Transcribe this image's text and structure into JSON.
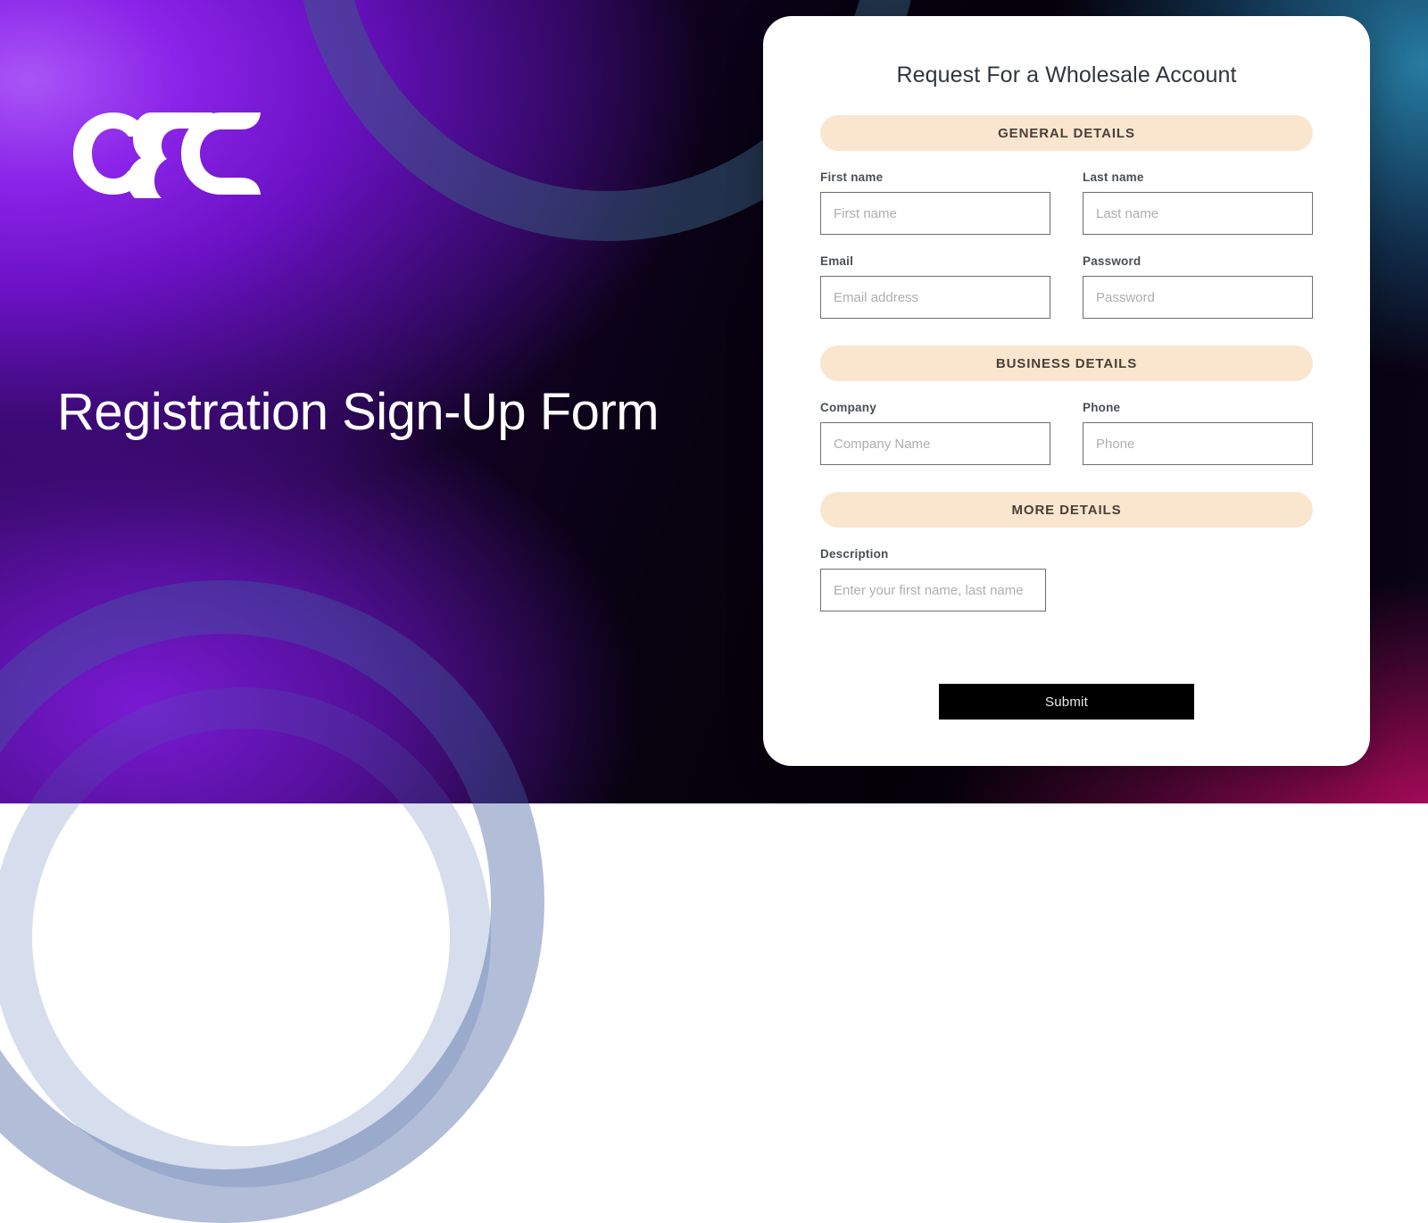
{
  "brand": {
    "logo_name": "osc-logo",
    "headline": "Registration Sign-Up Form"
  },
  "card": {
    "title": "Request For a Wholesale Account",
    "sections": [
      {
        "heading": "GENERAL DETAILS"
      },
      {
        "heading": "BUSINESS DETAILS"
      },
      {
        "heading": "MORE DETAILS"
      }
    ],
    "fields": {
      "first_name": {
        "label": "First name",
        "placeholder": "First name",
        "value": ""
      },
      "last_name": {
        "label": "Last name",
        "placeholder": "Last name",
        "value": ""
      },
      "email": {
        "label": "Email",
        "placeholder": "Email address",
        "value": ""
      },
      "password": {
        "label": "Password",
        "placeholder": "Password",
        "value": ""
      },
      "company": {
        "label": "Company",
        "placeholder": "Company Name",
        "value": ""
      },
      "phone": {
        "label": "Phone",
        "placeholder": "Phone",
        "value": ""
      },
      "description": {
        "label": "Description",
        "placeholder": "Enter your first name, last name",
        "value": ""
      }
    },
    "submit_label": "Submit"
  },
  "colors": {
    "pill_background": "#fae5cf",
    "pill_text": "#4a4038",
    "submit_background": "#000000",
    "submit_text": "#e8e8e8",
    "card_background": "#ffffff",
    "accent_purple": "#8b24e8",
    "accent_magenta": "#aa0a5a",
    "accent_teal": "#2882aa",
    "input_border": "#6e6e6e",
    "label_text": "#4a4f55",
    "placeholder_text": "#aeaeae",
    "title_text": "#30363c"
  }
}
